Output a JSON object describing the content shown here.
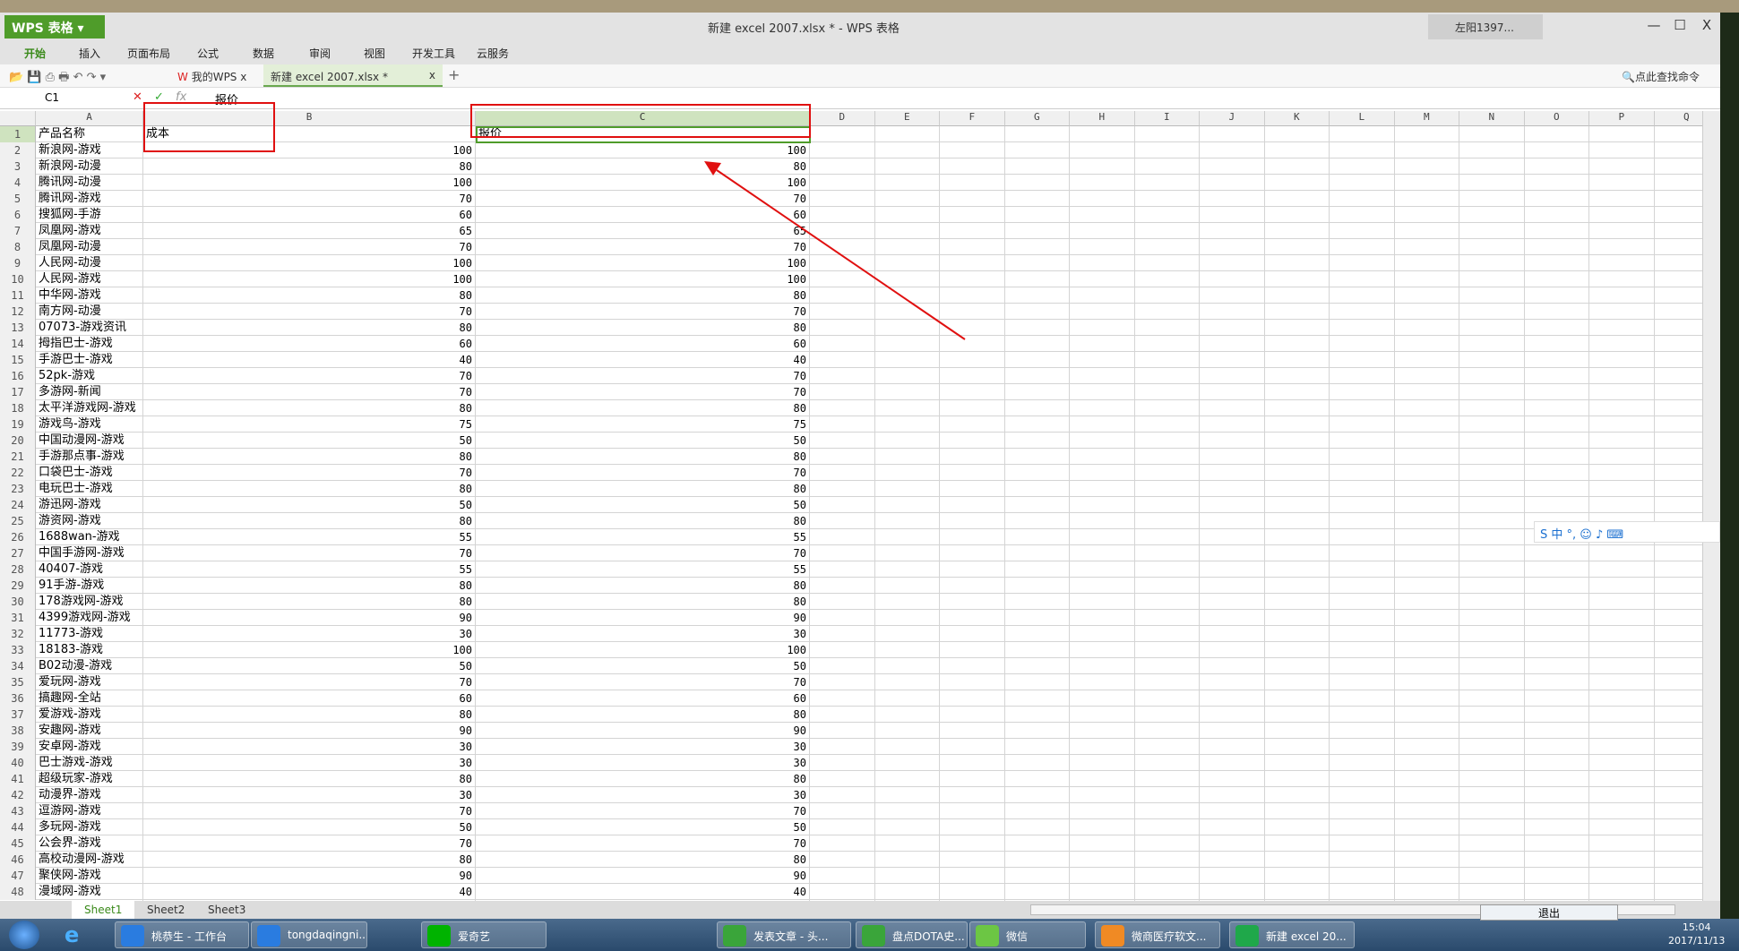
{
  "window": {
    "app_button": "WPS 表格",
    "title": "新建 excel 2007.xlsx * - WPS 表格",
    "user": "左阳1397...",
    "minimize": "—",
    "maximize": "☐",
    "close": "X"
  },
  "menu": [
    "开始",
    "插入",
    "页面布局",
    "公式",
    "数据",
    "审阅",
    "视图",
    "开发工具",
    "云服务"
  ],
  "tabs": {
    "home": "我的WPS",
    "doc": "新建 excel 2007.xlsx *",
    "close": "x",
    "add": "+",
    "search": "点此查找命令"
  },
  "formula": {
    "cell": "C1",
    "cancel": "✕",
    "confirm": "✓",
    "fx": "fx",
    "value": "报价"
  },
  "columns": [
    "A",
    "B",
    "C",
    "D",
    "E",
    "F",
    "G",
    "H",
    "I",
    "J",
    "K",
    "L",
    "M",
    "N",
    "O",
    "P",
    "Q"
  ],
  "selected_column": "C",
  "header_row": {
    "a": "产品名称",
    "b": "成本",
    "c": "报价"
  },
  "rows": [
    [
      "新浪网-游戏",
      100,
      100
    ],
    [
      "新浪网-动漫",
      80,
      80
    ],
    [
      "腾讯网-动漫",
      100,
      100
    ],
    [
      "腾讯网-游戏",
      70,
      70
    ],
    [
      "搜狐网-手游",
      60,
      60
    ],
    [
      "凤凰网-游戏",
      65,
      65
    ],
    [
      "凤凰网-动漫",
      70,
      70
    ],
    [
      "人民网-动漫",
      100,
      100
    ],
    [
      "人民网-游戏",
      100,
      100
    ],
    [
      "中华网-游戏",
      80,
      80
    ],
    [
      "南方网-动漫",
      70,
      70
    ],
    [
      "07073-游戏资讯",
      80,
      80
    ],
    [
      "拇指巴士-游戏",
      60,
      60
    ],
    [
      "手游巴士-游戏",
      40,
      40
    ],
    [
      "52pk-游戏",
      70,
      70
    ],
    [
      "多游网-新闻",
      70,
      70
    ],
    [
      "太平洋游戏网-游戏",
      80,
      80
    ],
    [
      "游戏鸟-游戏",
      75,
      75
    ],
    [
      "中国动漫网-游戏",
      50,
      50
    ],
    [
      "手游那点事-游戏",
      80,
      80
    ],
    [
      "口袋巴士-游戏",
      70,
      70
    ],
    [
      "电玩巴士-游戏",
      80,
      80
    ],
    [
      "游迅网-游戏",
      50,
      50
    ],
    [
      "游资网-游戏",
      80,
      80
    ],
    [
      "1688wan-游戏",
      55,
      55
    ],
    [
      "中国手游网-游戏",
      70,
      70
    ],
    [
      "40407-游戏",
      55,
      55
    ],
    [
      "91手游-游戏",
      80,
      80
    ],
    [
      "178游戏网-游戏",
      80,
      80
    ],
    [
      "4399游戏网-游戏",
      90,
      90
    ],
    [
      "11773-游戏",
      30,
      30
    ],
    [
      "18183-游戏",
      100,
      100
    ],
    [
      "B02动漫-游戏",
      50,
      50
    ],
    [
      "爱玩网-游戏",
      70,
      70
    ],
    [
      "搞趣网-全站",
      60,
      60
    ],
    [
      "爱游戏-游戏",
      80,
      80
    ],
    [
      "安趣网-游戏",
      90,
      90
    ],
    [
      "安卓网-游戏",
      30,
      30
    ],
    [
      "巴士游戏-游戏",
      30,
      30
    ],
    [
      "超级玩家-游戏",
      80,
      80
    ],
    [
      "动漫界-游戏",
      30,
      30
    ],
    [
      "逗游网-游戏",
      70,
      70
    ],
    [
      "多玩网-游戏",
      50,
      50
    ],
    [
      "公会界-游戏",
      70,
      70
    ],
    [
      "高校动漫网-游戏",
      80,
      80
    ],
    [
      "聚侠网-游戏",
      90,
      90
    ],
    [
      "漫域网-游戏",
      40,
      40
    ]
  ],
  "sheets": [
    "Sheet1",
    "Sheet2",
    "Sheet3"
  ],
  "ime": "S 中 °, ☺ ♪ ⌨",
  "taskbar": {
    "items": [
      {
        "label": "桃恭生 - 工作台",
        "color": "#2a7ce0"
      },
      {
        "label": "tongdaqingni...",
        "color": "#2a7ce0"
      },
      {
        "label": "爱奇艺",
        "color": "#00b300"
      },
      {
        "label": "发表文章 - 头...",
        "color": "#3aa53a"
      },
      {
        "label": "盘点DOTA史...",
        "color": "#3aa53a"
      },
      {
        "label": "微信",
        "color": "#6cc644"
      },
      {
        "label": "微商医疗软文...",
        "color": "#f08a24"
      },
      {
        "label": "新建 excel 20...",
        "color": "#1fa84a"
      }
    ],
    "popup": "退出",
    "time": "15:04",
    "date": "2017/11/13"
  },
  "colors": {
    "accent": "#4f9c2a",
    "annotation": "#e01010",
    "selection": "#cfe3bf"
  }
}
